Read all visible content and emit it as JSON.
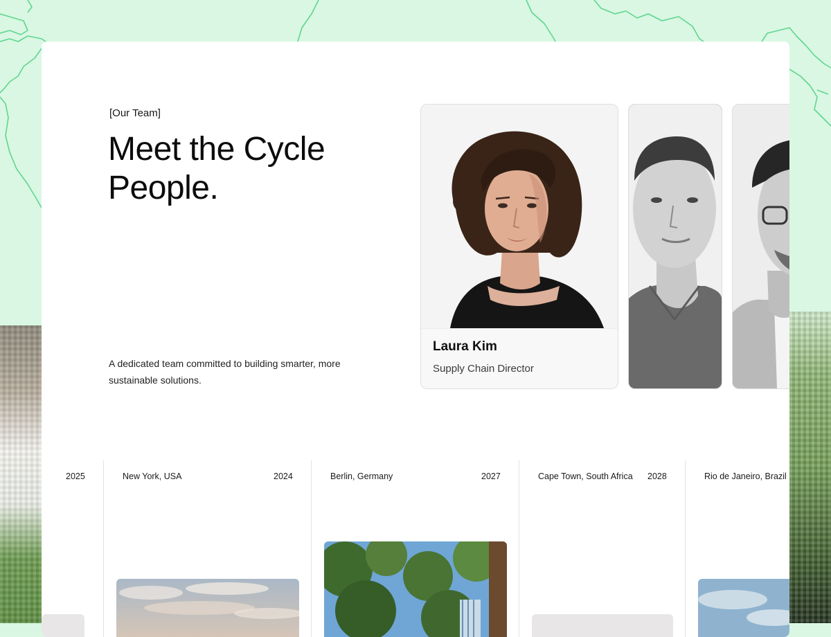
{
  "section": {
    "eyebrow": "[Our Team]",
    "headline_line1": "Meet the Cycle",
    "headline_line2": "People.",
    "description_line1": "A dedicated team committed to building smarter, more",
    "description_line2": "sustainable solutions."
  },
  "team": [
    {
      "name": "Laura Kim",
      "role": "Supply Chain Director",
      "photo": "woman-portrait-curly-hair"
    },
    {
      "photo": "man-portrait-grayscale"
    },
    {
      "photo": "man-portrait-glasses-grayscale"
    }
  ],
  "timeline": [
    {
      "location": "",
      "year": "2025",
      "image": "gray-placeholder"
    },
    {
      "location": "New York, USA",
      "year": "2024",
      "image": "cloudy-sky"
    },
    {
      "location": "Berlin, Germany",
      "year": "2027",
      "image": "trees-blue-sky"
    },
    {
      "location": "Cape Town, South Africa",
      "year": "2028",
      "image": "gray-placeholder"
    },
    {
      "location": "Rio de Janeiro, Brazil",
      "year": "",
      "image": "blue-sky"
    }
  ],
  "colors": {
    "background_mint": "#d9f7e3",
    "map_lines": "#5fd68f",
    "card_border": "#dedede",
    "text_primary": "#0c0c0c"
  }
}
